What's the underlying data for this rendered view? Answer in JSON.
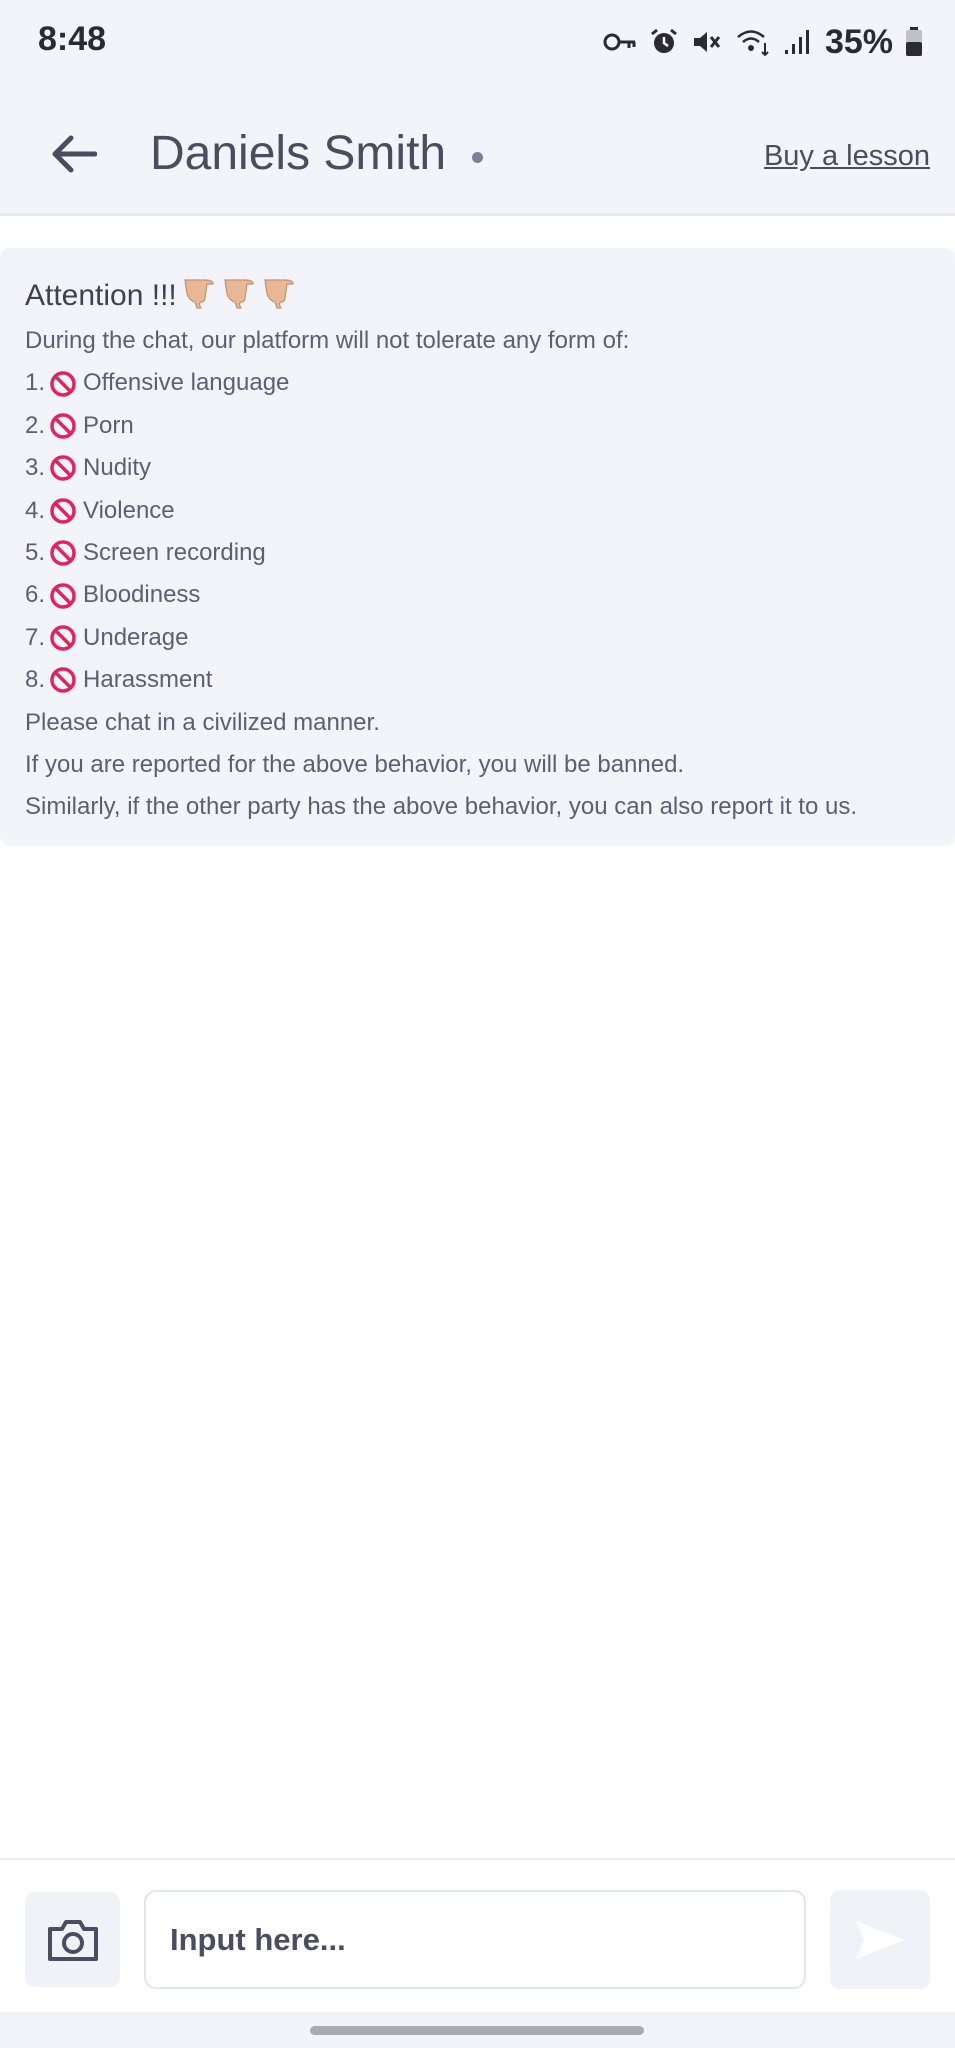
{
  "status_bar": {
    "time": "8:48",
    "battery_percent": "35%",
    "icons": [
      "key-icon",
      "alarm-icon",
      "mute-icon",
      "wifi-icon",
      "signal-icon",
      "battery-icon"
    ]
  },
  "header": {
    "contact_name": "Daniels Smith",
    "buy_lesson_label": "Buy a lesson"
  },
  "notice": {
    "title": "Attention !!!",
    "intro": "During the chat, our platform will not tolerate any form of:",
    "rules": [
      {
        "number": "1.",
        "text": "Offensive language"
      },
      {
        "number": "2.",
        "text": "Porn"
      },
      {
        "number": "3.",
        "text": "Nudity"
      },
      {
        "number": "4.",
        "text": "Violence"
      },
      {
        "number": "5.",
        "text": "Screen recording"
      },
      {
        "number": "6.",
        "text": "Bloodiness"
      },
      {
        "number": "7.",
        "text": "Underage"
      },
      {
        "number": "8.",
        "text": "Harassment"
      }
    ],
    "closing": [
      "Please chat in a civilized manner.",
      "If you are reported for the above behavior, you will be banned.",
      "Similarly, if the other party has the above behavior, you can also report it to us."
    ]
  },
  "input_bar": {
    "placeholder": "Input here..."
  },
  "colors": {
    "background": "#ffffff",
    "panel": "#f3f4f9",
    "text": "#4a4d60",
    "ban_red": "#e0245e"
  }
}
